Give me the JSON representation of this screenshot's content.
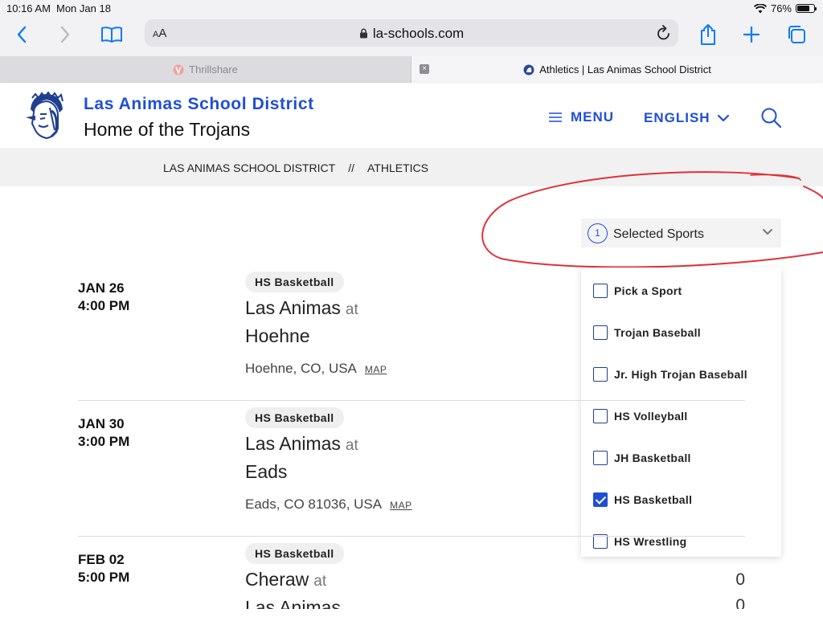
{
  "status": {
    "time": "10:16 AM",
    "date": "Mon Jan 18",
    "battery": "76%",
    "battery_level": 0.76
  },
  "toolbar": {
    "reader_label_big": "A",
    "reader_label_small": "A",
    "url": "la-schools.com"
  },
  "tabs": [
    {
      "title": "Thrillshare",
      "active": false
    },
    {
      "title": "Athletics | Las Animas School District",
      "active": true,
      "close": "×"
    }
  ],
  "site": {
    "district": "Las Animas School District",
    "tagline": "Home of the Trojans",
    "menu_label": "MENU",
    "language_label": "ENGLISH"
  },
  "breadcrumb": {
    "items": [
      "LAS ANIMAS SCHOOL DISTRICT",
      "ATHLETICS"
    ],
    "separator": "//"
  },
  "filter": {
    "count": "1",
    "label": "Selected Sports",
    "options": [
      {
        "label": "Pick a Sport",
        "checked": false
      },
      {
        "label": "Trojan Baseball",
        "checked": false
      },
      {
        "label": "Jr. High Trojan Baseball",
        "checked": false
      },
      {
        "label": "HS Volleyball",
        "checked": false
      },
      {
        "label": "JH Basketball",
        "checked": false
      },
      {
        "label": "HS Basketball",
        "checked": true
      },
      {
        "label": "HS Wrestling",
        "checked": false
      }
    ]
  },
  "events": [
    {
      "date": "JAN 26",
      "time": "4:00 PM",
      "sport": "HS Basketball",
      "home": "Las Animas",
      "at": "at",
      "away": "Hoehne",
      "location": "Hoehne, CO, USA",
      "map": "MAP"
    },
    {
      "date": "JAN 30",
      "time": "3:00 PM",
      "sport": "HS Basketball",
      "home": "Las Animas",
      "at": "at",
      "away": "Eads",
      "location": "Eads, CO 81036, USA",
      "map": "MAP"
    },
    {
      "date": "FEB 02",
      "time": "5:00 PM",
      "sport": "HS Basketball",
      "home": "Cheraw",
      "at": "at",
      "away": "Las Animas",
      "home_score": "0",
      "away_score": "0"
    }
  ],
  "colors": {
    "brand_blue": "#1f4fd6",
    "ios_blue": "#0a7aff",
    "annotation_red": "#e0303a"
  }
}
